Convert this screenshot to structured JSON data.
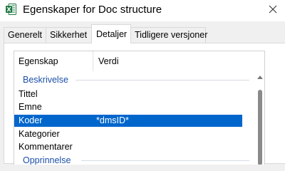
{
  "window": {
    "title": "Egenskaper for Doc structure",
    "close_symbol": "✕",
    "app_icon": "excel-icon",
    "app_icon_color": "#1f7a45"
  },
  "tabs": [
    {
      "label": "Generelt",
      "active": false
    },
    {
      "label": "Sikkerhet",
      "active": false
    },
    {
      "label": "Detaljer",
      "active": true
    },
    {
      "label": "Tidligere versjoner",
      "active": false
    }
  ],
  "details": {
    "columns": {
      "property": "Egenskap",
      "value": "Verdi"
    },
    "groups": [
      {
        "label": "Beskrivelse",
        "rows": [
          {
            "name": "Tittel",
            "value": ""
          },
          {
            "name": "Emne",
            "value": ""
          },
          {
            "name": "Koder",
            "value": "*dmsID*",
            "selected": true
          },
          {
            "name": "Kategorier",
            "value": ""
          },
          {
            "name": "Kommentarer",
            "value": ""
          }
        ]
      },
      {
        "label": "Opprinnelse",
        "rows": []
      }
    ]
  },
  "colors": {
    "selection": "#0066cc",
    "group_header": "#1c4fa8"
  }
}
